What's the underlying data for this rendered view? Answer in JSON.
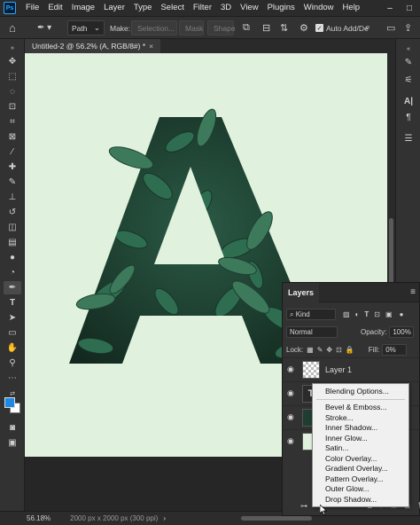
{
  "menubar": {
    "logo": "Ps",
    "items": [
      "File",
      "Edit",
      "Image",
      "Layer",
      "Type",
      "Select",
      "Filter",
      "3D",
      "View",
      "Plugins",
      "Window",
      "Help"
    ]
  },
  "options": {
    "mode": "Path",
    "make_label": "Make:",
    "selection_btn": "Selection...",
    "mask_btn": "Mask",
    "shape_btn": "Shape",
    "auto_add": "Auto Add/De"
  },
  "document": {
    "tab_title": "Untitled-2 @ 56.2% (A, RGB/8#) *",
    "tab_close": "×"
  },
  "status": {
    "zoom": "56.18%",
    "dimensions": "2000 px x 2000 px (300 ppi)",
    "arrow": "›"
  },
  "layers_panel": {
    "tab": "Layers",
    "kind": "Kind",
    "blend_mode": "Normal",
    "opacity_label": "Opacity:",
    "opacity": "100%",
    "lock_label": "Lock:",
    "fill_label": "Fill:",
    "fill": "0%",
    "layers": [
      {
        "name": "Layer 1"
      },
      {
        "name": ""
      },
      {
        "name": ""
      },
      {
        "name": ""
      }
    ]
  },
  "context_menu": {
    "items": [
      "Blending Options...",
      "Bevel & Emboss...",
      "Stroke...",
      "Inner Shadow...",
      "Inner Glow...",
      "Satin...",
      "Color Overlay...",
      "Gradient Overlay...",
      "Pattern Overlay...",
      "Outer Glow...",
      "Drop Shadow..."
    ]
  },
  "colors": {
    "canvas_bg": "#e0f2de",
    "foreground": "#1e88e5",
    "background": "#ffffff",
    "leaf_dark": "#1d3f32",
    "leaf_light": "#3d7a5c"
  },
  "icons": {
    "home": "home-icon",
    "pen": "pen-icon"
  }
}
